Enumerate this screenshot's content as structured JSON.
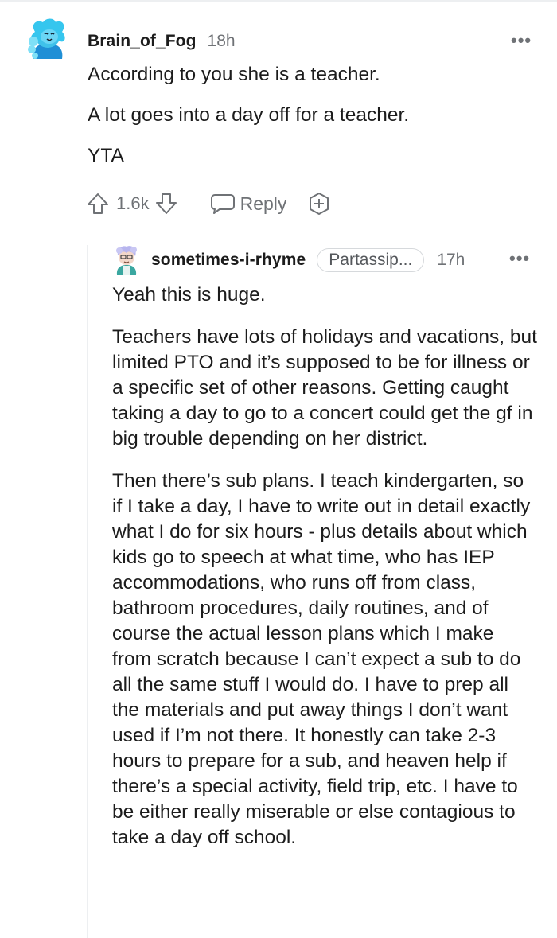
{
  "comment": {
    "username": "Brain_of_Fog",
    "time": "18h",
    "paragraphs": [
      "According to you she is a teacher.",
      "A lot goes into a day off for a teacher.",
      "YTA"
    ],
    "votes": "1.6k",
    "reply_label": "Reply",
    "more_label": "•••"
  },
  "reply": {
    "username": "sometimes-i-rhyme",
    "flair": "Partassip...",
    "time": "17h",
    "more_label": "•••",
    "paragraphs": [
      "Yeah this is huge.",
      "Teachers have lots of holidays and vacations, but limited PTO and it’s supposed to be for illness or a specific set of other reasons. Getting caught taking a day to go to a concert could get the gf in big trouble depending on her district.",
      "Then there’s sub plans. I teach kindergarten, so if I take a day, I have to write out in detail exactly what I do for six hours - plus details about which kids go to speech at what time, who has IEP accommodations, who runs off from class, bathroom procedures, daily routines, and of course the actual lesson plans which I make from scratch because I can’t expect a sub to do all the same stuff I would do. I have to prep all the materials and put away things I don’t want used if I’m not there. It honestly can take 2-3 hours to prepare for a sub, and heaven help if there’s a special activity, field trip, etc. I have to be either really miserable or else contagious to take a day off school."
    ]
  },
  "colors": {
    "text": "#1c1c1c",
    "meta": "#6f7276",
    "avatar1": "#35c3e6",
    "avatar2": "#a7a8ec"
  }
}
